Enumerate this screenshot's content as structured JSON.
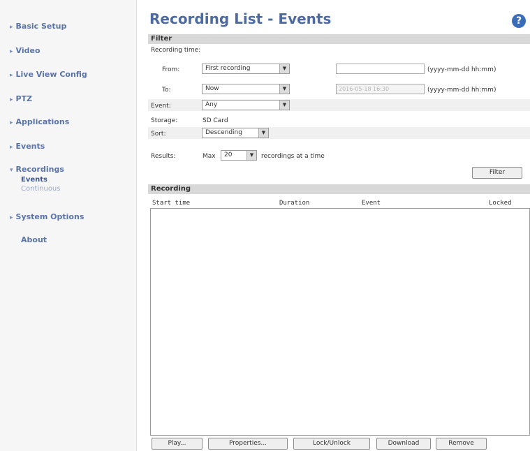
{
  "sidebar": {
    "items": [
      {
        "label": "Basic Setup"
      },
      {
        "label": "Video"
      },
      {
        "label": "Live View Config"
      },
      {
        "label": "PTZ"
      },
      {
        "label": "Applications"
      },
      {
        "label": "Events"
      },
      {
        "label": "Recordings"
      },
      {
        "label": "System Options"
      },
      {
        "label": "About"
      }
    ],
    "sub_items": [
      {
        "label": "Events"
      },
      {
        "label": "Continuous"
      }
    ]
  },
  "page": {
    "title": "Recording List - Events",
    "help_icon": "?"
  },
  "filter": {
    "section_label": "Filter",
    "recording_time_label": "Recording time:",
    "from_label": "From:",
    "from_value": "First recording",
    "from_text_value": "",
    "from_format": "(yyyy-mm-dd hh:mm)",
    "to_label": "To:",
    "to_value": "Now",
    "to_text_value": "2016-05-18 16:30",
    "to_format": "(yyyy-mm-dd hh:mm)",
    "event_label": "Event:",
    "event_value": "Any",
    "storage_label": "Storage:",
    "storage_value": "SD Card",
    "sort_label": "Sort:",
    "sort_value": "Descending",
    "results_label": "Results:",
    "results_prefix": "Max",
    "results_value": "20",
    "results_suffix": "recordings at a time",
    "filter_button": "Filter"
  },
  "recording": {
    "section_label": "Recording",
    "columns": [
      "Start time",
      "Duration",
      "Event",
      "Locked"
    ],
    "rows": []
  },
  "actions": {
    "play": "Play...",
    "properties": "Properties...",
    "lock_unlock": "Lock/Unlock",
    "download": "Download",
    "remove": "Remove"
  }
}
